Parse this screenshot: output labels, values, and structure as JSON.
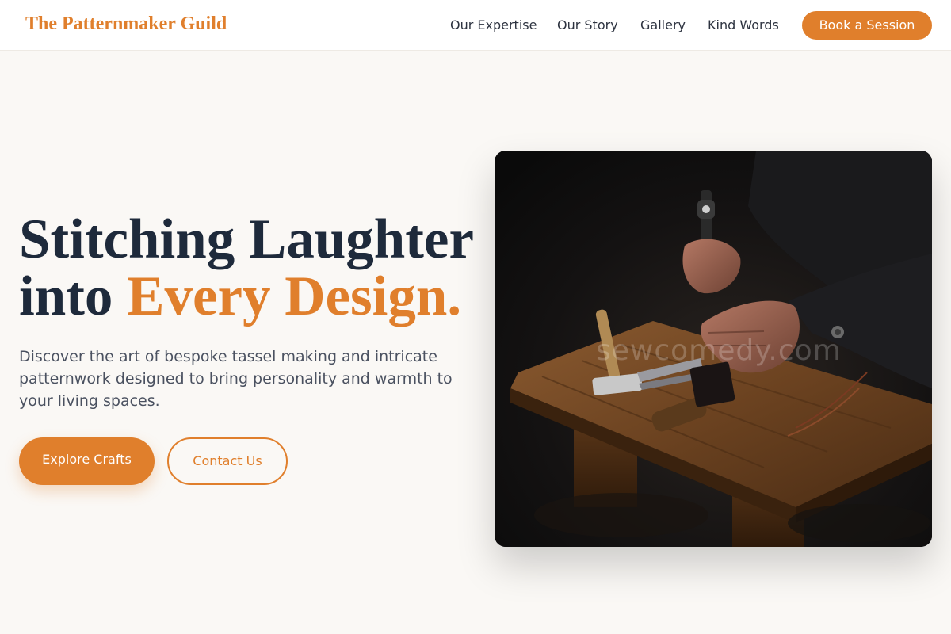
{
  "brand": {
    "name": "The Patternmaker Guild"
  },
  "nav": {
    "items": [
      {
        "label": "Our Expertise"
      },
      {
        "label": "Our Story"
      },
      {
        "label": "Gallery"
      },
      {
        "label": "Kind Words"
      }
    ],
    "cta_label": "Book a Session"
  },
  "hero": {
    "title_line1": "Stitching Laughter",
    "title_line2_prefix": "into",
    "title_line2_accent": "Every Design.",
    "description": "Discover the art of bespoke tassel making and intricate patternwork designed to bring personality and warmth to your living spaces.",
    "primary_button": "Explore Crafts",
    "secondary_button": "Contact Us",
    "image_watermark": "sewcomedy.com"
  },
  "colors": {
    "accent": "#e07f2c",
    "heading": "#1e2a3b",
    "body_text": "#4a5160",
    "background": "#faf8f5"
  }
}
